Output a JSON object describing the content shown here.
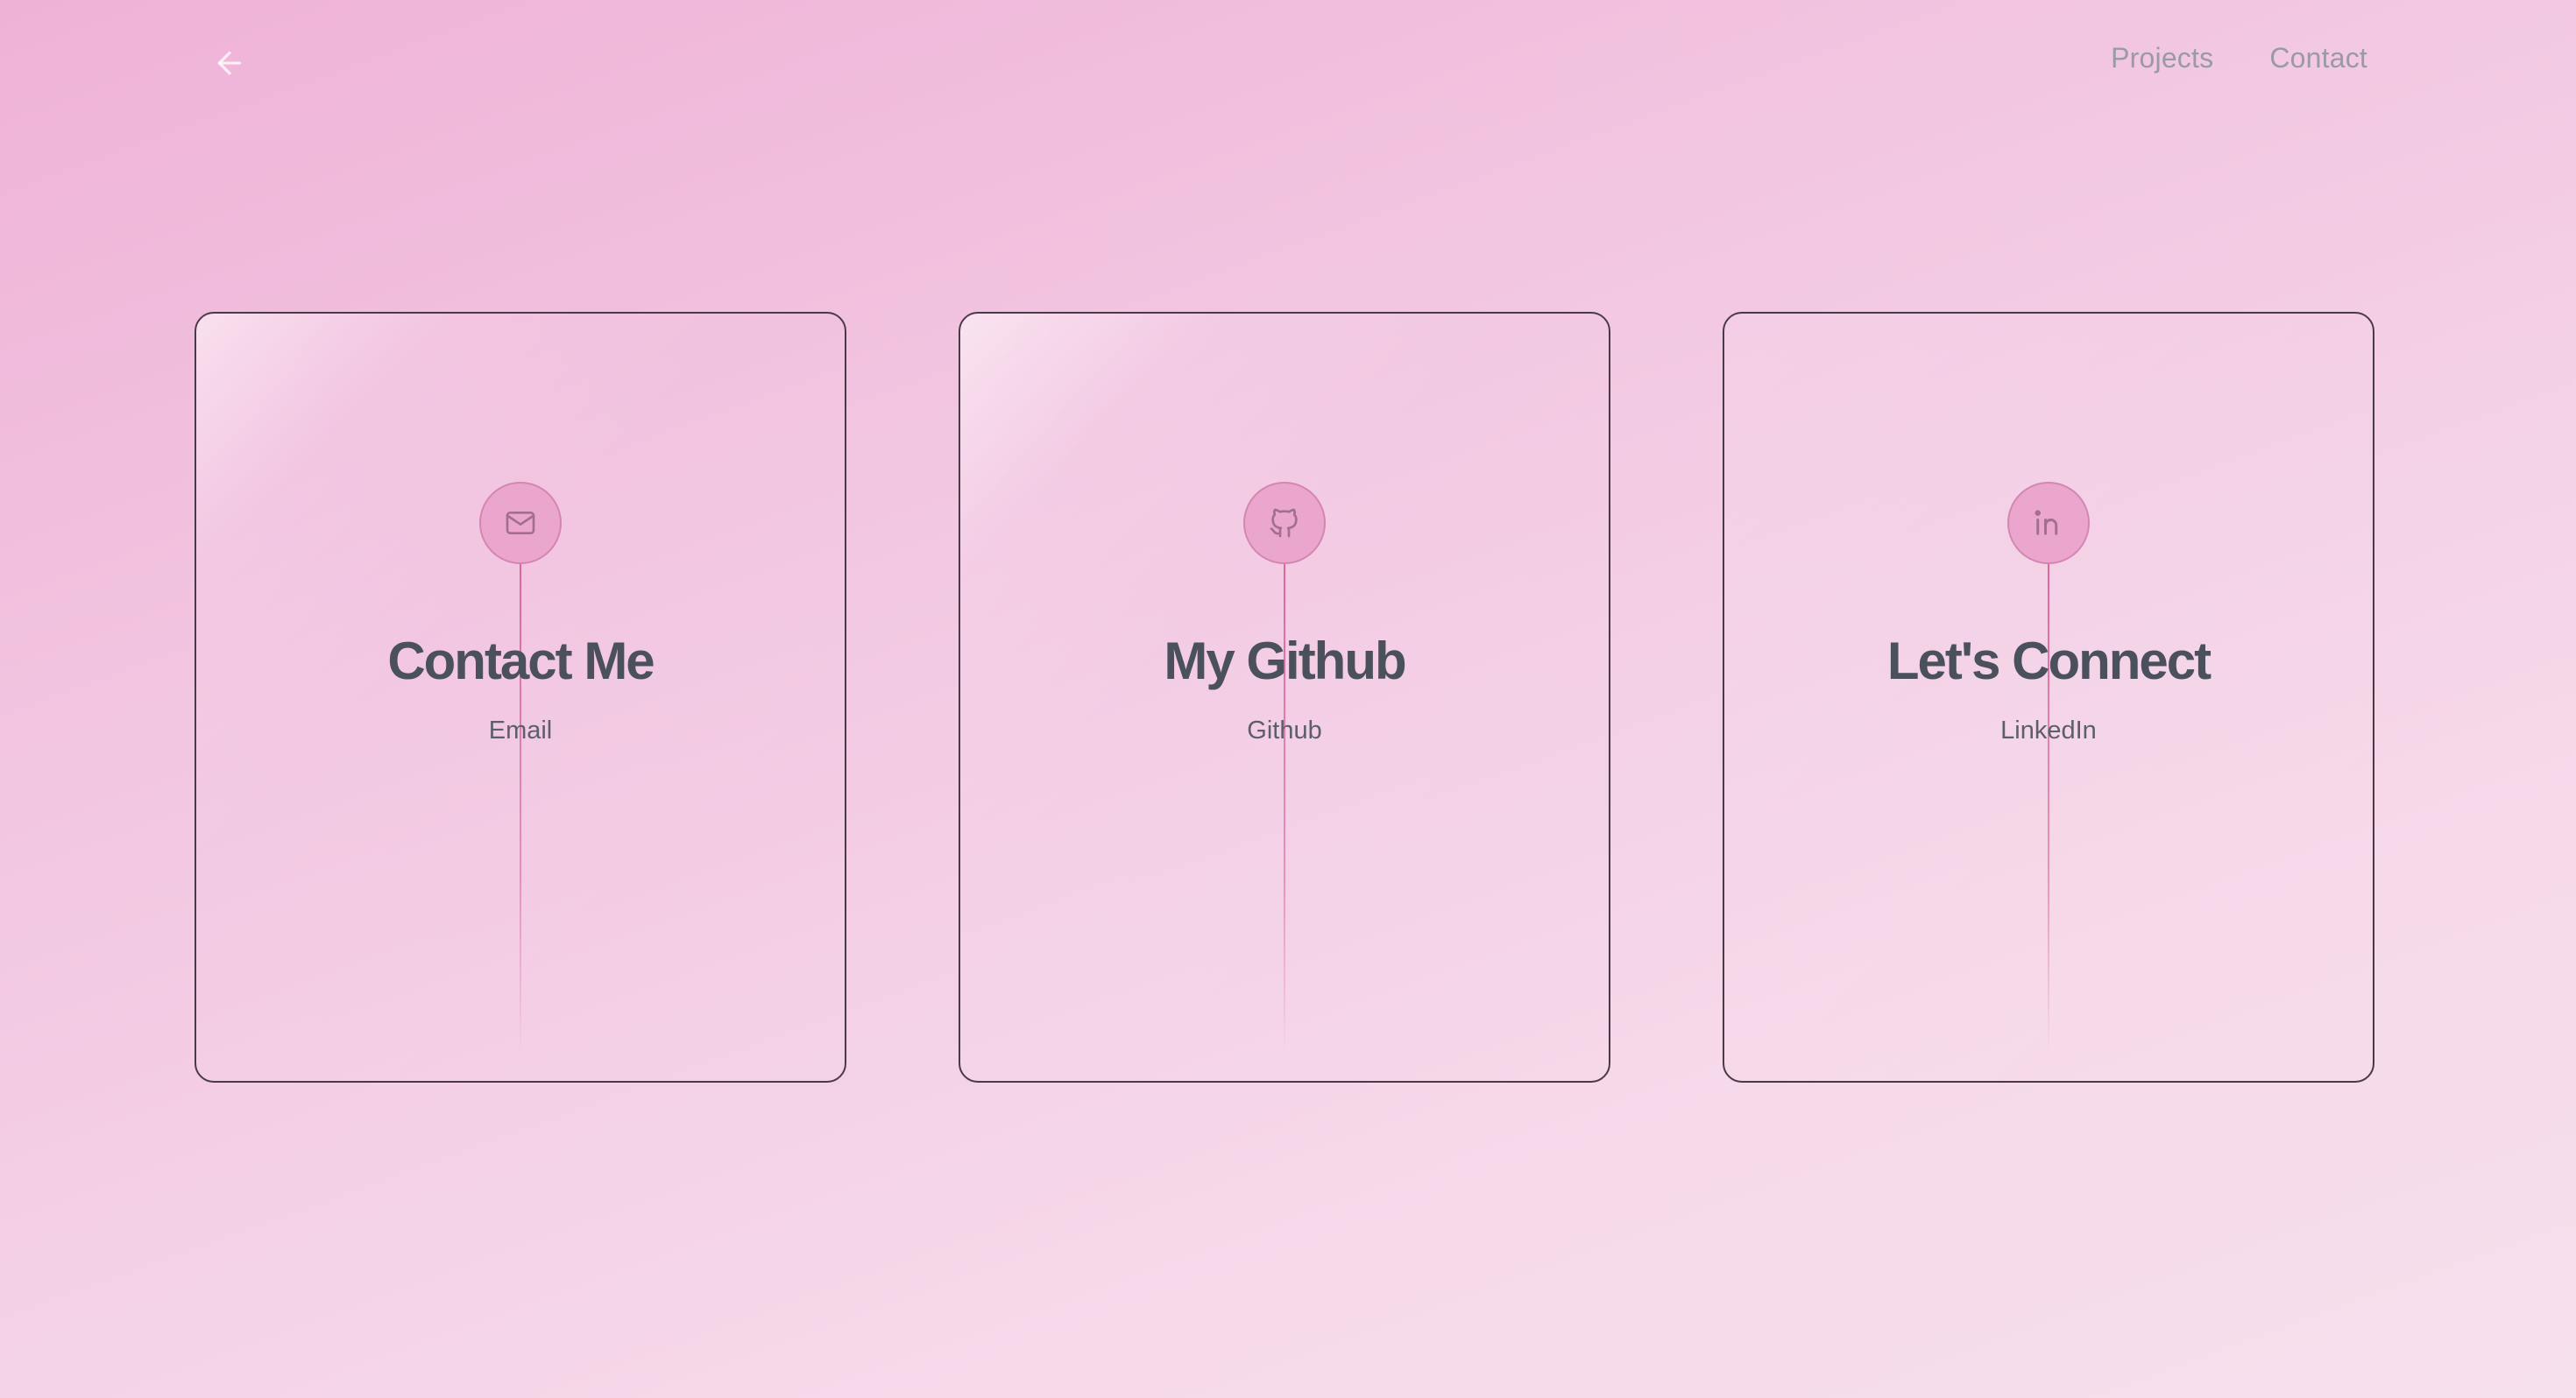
{
  "nav": {
    "back_icon": "arrow-left-icon",
    "links": [
      {
        "label": "Projects"
      },
      {
        "label": "Contact"
      }
    ]
  },
  "cards": [
    {
      "icon": "mail-icon",
      "title": "Contact Me",
      "subtitle": "Email"
    },
    {
      "icon": "github-icon",
      "title": "My Github",
      "subtitle": "Github"
    },
    {
      "icon": "linkedin-icon",
      "title": "Let's Connect",
      "subtitle": "LinkedIn"
    }
  ],
  "colors": {
    "accent_line": "#dd5c96",
    "icon_circle": "#eba6cd",
    "card_border": "#4a3a48",
    "title_text": "#4a505c",
    "nav_text": "#9a9aa6"
  }
}
